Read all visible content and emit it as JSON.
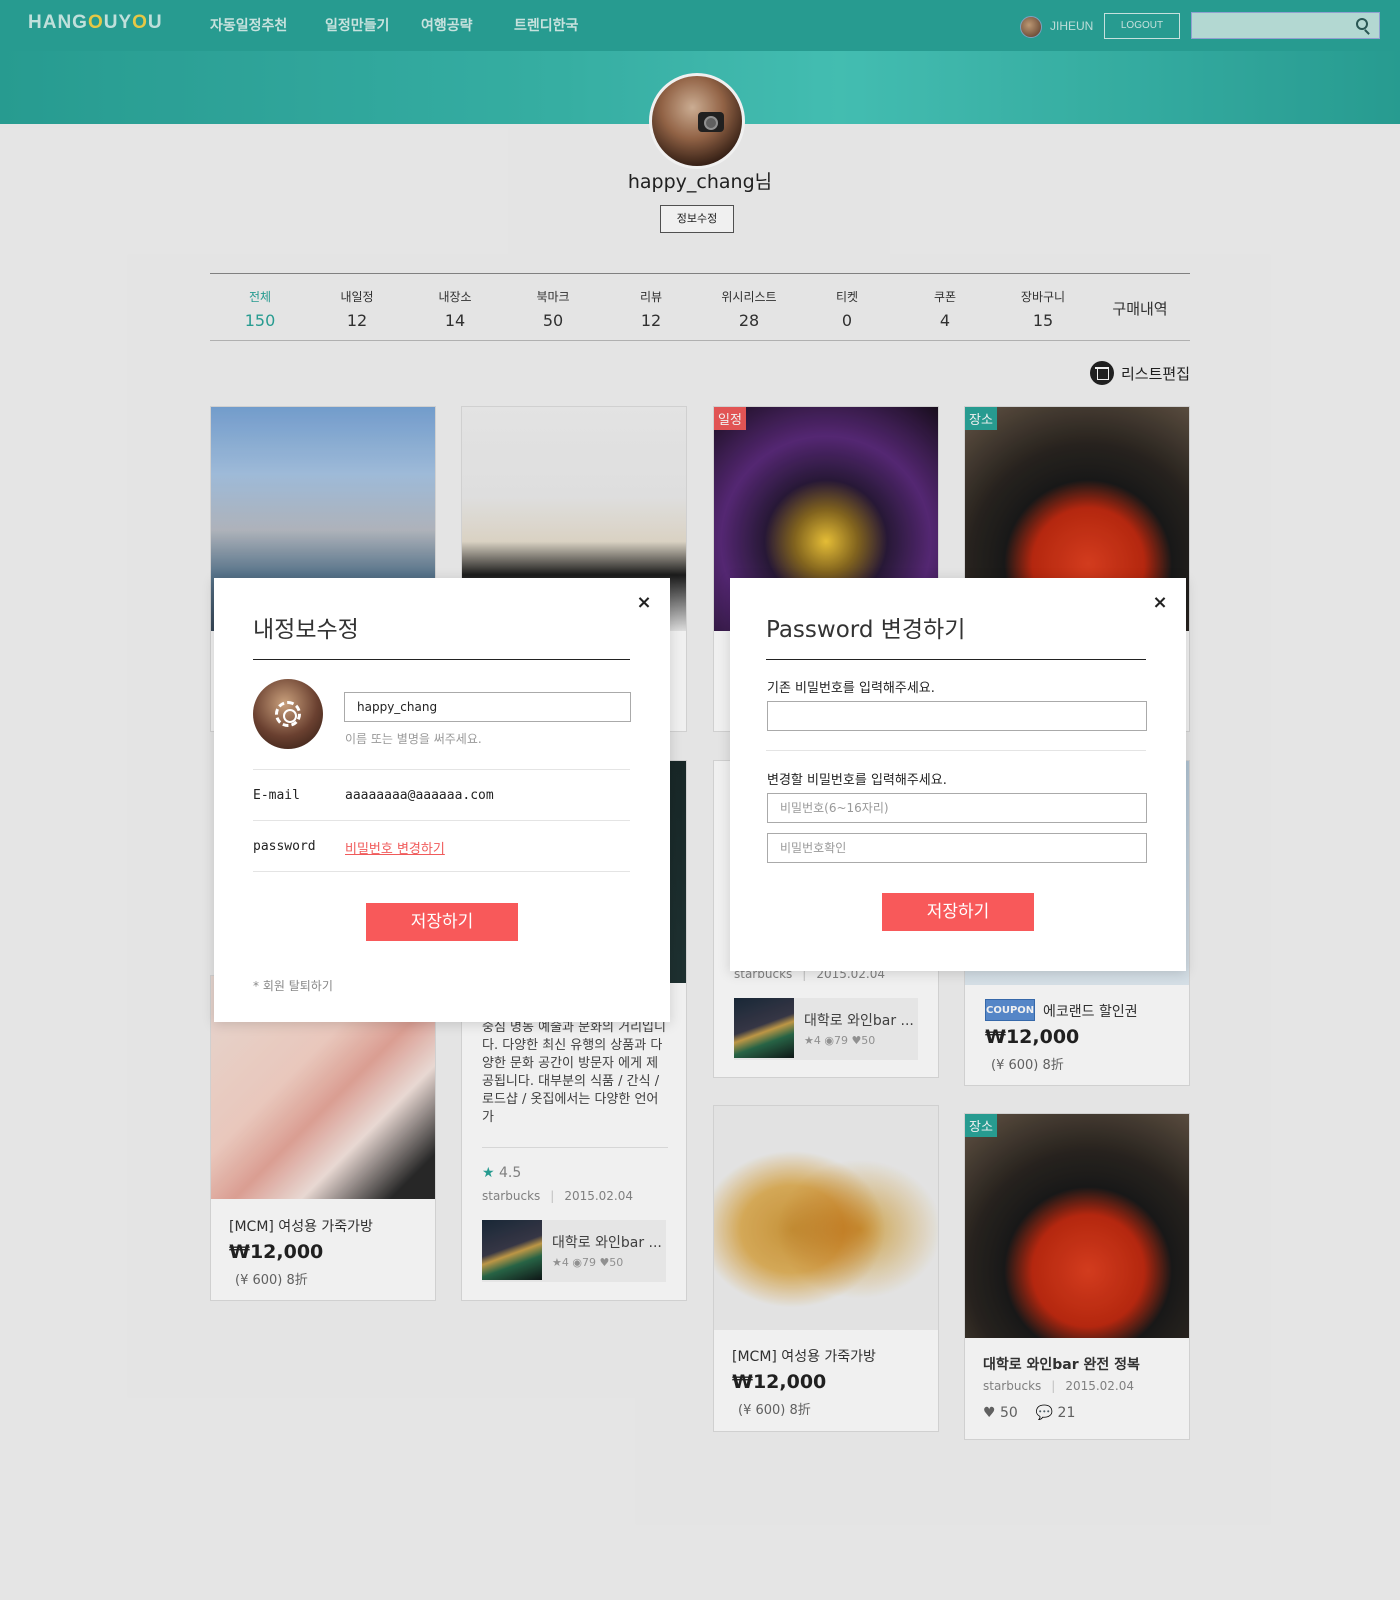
{
  "header": {
    "logo": {
      "pre": "HANG",
      "o1": "O",
      "mid": "UY",
      "o2": "O",
      "post": "U"
    },
    "nav": [
      "자동일정추천",
      "일정만들기",
      "여행공략",
      "트렌디한국"
    ],
    "user_name": "JIHEUN",
    "logout_label": "LOGOUT",
    "search_placeholder": ""
  },
  "profile": {
    "name": "happy_chang님",
    "edit_label": "정보수정"
  },
  "stats": [
    {
      "label": "전체",
      "count": "150"
    },
    {
      "label": "내일정",
      "count": "12"
    },
    {
      "label": "내장소",
      "count": "14"
    },
    {
      "label": "북마크",
      "count": "50"
    },
    {
      "label": "리뷰",
      "count": "12"
    },
    {
      "label": "위시리스트",
      "count": "28"
    },
    {
      "label": "티켓",
      "count": "0"
    },
    {
      "label": "쿠폰",
      "count": "4"
    },
    {
      "label": "장바구니",
      "count": "15"
    },
    {
      "label": "구매내역",
      "count": ""
    }
  ],
  "list_edit_label": "리스트편집",
  "cards": {
    "c2_badge": "일정",
    "c3_badge": "장소",
    "c7_author": "starbucks",
    "c7_date": "2015.02.04",
    "c7_mini_title": "대학로 와인bar ...",
    "c7_mini_stats": "★4 ◉79 ♥50",
    "coupon_label": "COUPON",
    "coupon_title": "에코랜드 할인권",
    "coupon_price": "₩12,000",
    "coupon_sub": "(¥ 600) 8折",
    "c4_title": "[MCM] 여성용 가죽가방",
    "c4_price": "₩12,000",
    "c4_sub": "(¥ 600) 8折",
    "c5_text": "중심 명동 예술과 문화의 거리입니다. 다양한 최신 유행의 상품과 다양한 문화 공간이 방문자 에게 제공됩니다. 대부분의 식품 / 간식 / 로드샵 / 옷집에서는 다양한 언어가",
    "c5_rating": "4.5",
    "c5_author": "starbucks",
    "c5_date": "2015.02.04",
    "c5_mini_title": "대학로 와인bar ...",
    "c5_mini_stats": "★4 ◉79 ♥50",
    "c8_title": "[MCM] 여성용 가죽가방",
    "c8_price": "₩12,000",
    "c8_sub": "(¥ 600) 8折",
    "c9_badge": "장소",
    "c9_title": "대학로 와인bar 완전 정복",
    "c9_author": "starbucks",
    "c9_date": "2015.02.04",
    "c9_likes": "50",
    "c9_comments": "21"
  },
  "modal_profile": {
    "title": "내정보수정",
    "close": "×",
    "name_value": "happy_chang",
    "name_helper": "이름 또는 별명을 써주세요.",
    "email_label": "E-mail",
    "email_value": "aaaaaaaa@aaaaaa.com",
    "password_label": "password",
    "password_link": "비밀번호 변경하기",
    "save_label": "저장하기",
    "withdraw_label": "* 회원 탈퇴하기"
  },
  "modal_password": {
    "title": "Password 변경하기",
    "close": "×",
    "current_label": "기존 비밀번호를 입력해주세요.",
    "new_label": "변경할 비밀번호를 입력해주세요.",
    "new_placeholder": "비밀번호(6~16자리)",
    "confirm_placeholder": "비밀번호확인",
    "save_label": "저장하기"
  },
  "colors": {
    "brand": "#2aa59a",
    "accent": "#f8595a"
  }
}
